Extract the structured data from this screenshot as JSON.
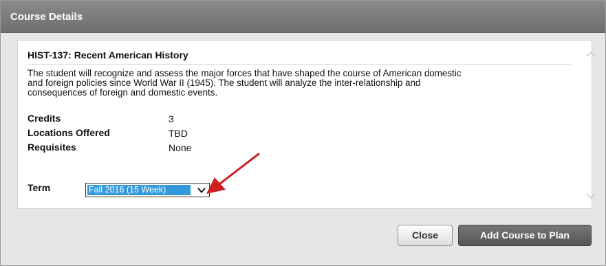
{
  "dialog": {
    "title": "Course Details"
  },
  "course": {
    "title": "HIST-137: Recent American History",
    "description_lines": [
      "The student will recognize and assess the major forces that have shaped the course of American domestic",
      "and foreign policies since World War II (1945). The student will analyze the inter-relationship and",
      "consequences of foreign and domestic events."
    ],
    "credits_label": "Credits",
    "credits_value": "3",
    "locations_label": "Locations Offered",
    "locations_value": "TBD",
    "requisites_label": "Requisites",
    "requisites_value": "None"
  },
  "term": {
    "label": "Term",
    "selected": "Fall 2016 (15 Week)"
  },
  "buttons": {
    "close": "Close",
    "add": "Add Course to Plan"
  },
  "colors": {
    "titlebar": "#7a7a7a",
    "selection": "#3399dd",
    "annotation_arrow": "#cc2222"
  },
  "icons": {
    "scroll_up": "chevron-up-icon",
    "scroll_down": "chevron-down-icon",
    "select": "chevron-down-icon",
    "annotation": "red-arrow-icon"
  }
}
